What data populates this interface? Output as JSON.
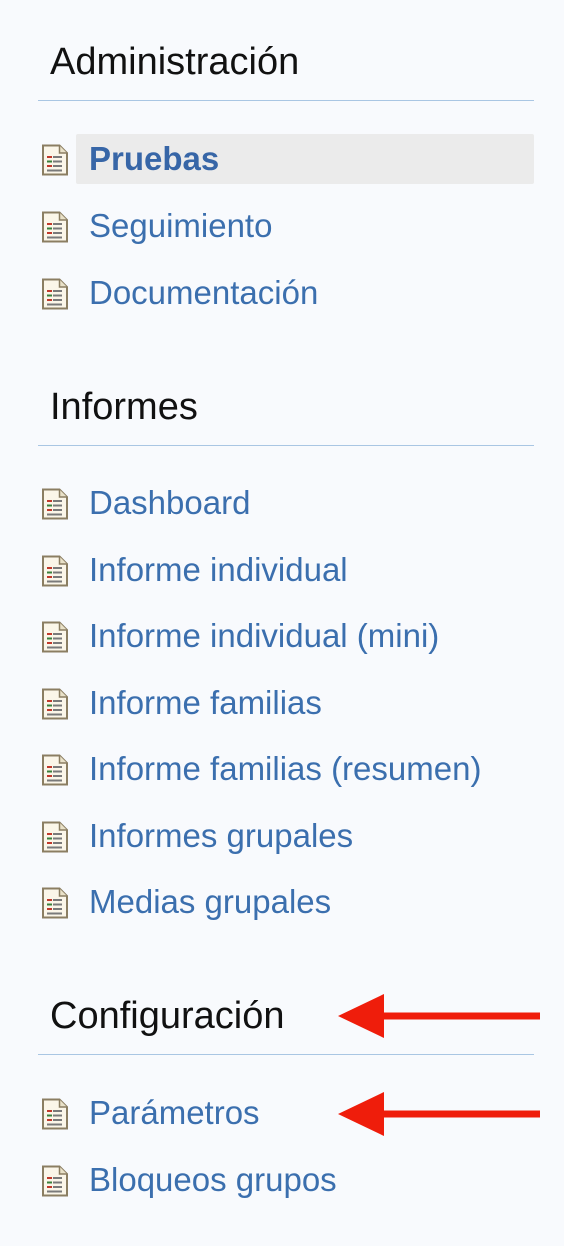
{
  "sections": [
    {
      "title": "Administración",
      "items": [
        {
          "label": "Pruebas",
          "active": true
        },
        {
          "label": "Seguimiento",
          "active": false
        },
        {
          "label": "Documentación",
          "active": false
        }
      ]
    },
    {
      "title": "Informes",
      "items": [
        {
          "label": "Dashboard",
          "active": false
        },
        {
          "label": "Informe individual",
          "active": false
        },
        {
          "label": "Informe individual (mini)",
          "active": false
        },
        {
          "label": "Informe familias",
          "active": false
        },
        {
          "label": "Informe familias (resumen)",
          "active": false
        },
        {
          "label": "Informes grupales",
          "active": false
        },
        {
          "label": "Medias grupales",
          "active": false
        }
      ]
    },
    {
      "title": "Configuración",
      "items": [
        {
          "label": "Parámetros",
          "active": false
        },
        {
          "label": "Bloqueos grupos",
          "active": false
        }
      ]
    }
  ],
  "icon": "document-icon",
  "annotations": {
    "arrow_color": "#ef1d0b"
  },
  "colors": {
    "link": "#3b6fae",
    "heading": "#111111",
    "rule": "#a9c6e3",
    "active_background": "#ebebeb",
    "page_background": "#f8fafd"
  }
}
